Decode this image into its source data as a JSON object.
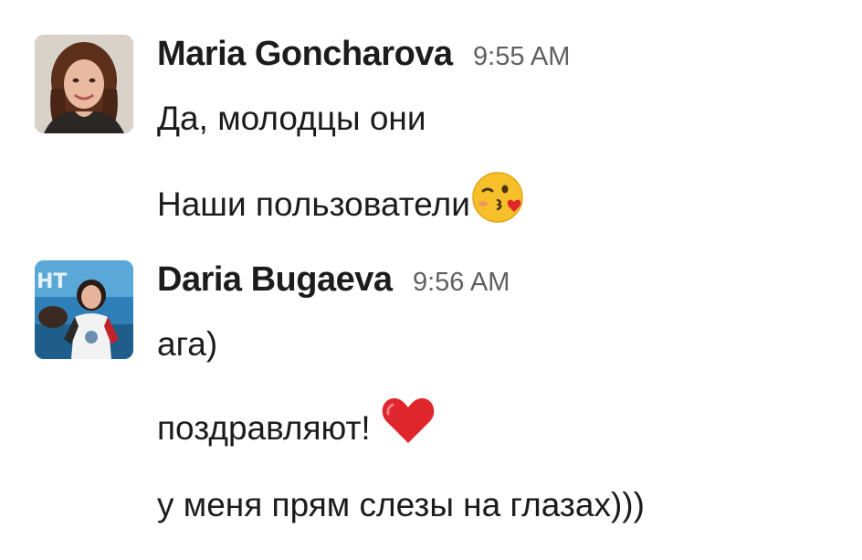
{
  "messages": [
    {
      "author": "Maria Goncharova",
      "time": "9:55 AM",
      "lines": [
        {
          "text": "Да, молодцы они",
          "emoji": ""
        },
        {
          "text": "Наши пользователи",
          "emoji": "kissing-heart-emoji"
        }
      ]
    },
    {
      "author": "Daria Bugaeva",
      "time": "9:56 AM",
      "lines": [
        {
          "text": "ага)",
          "emoji": ""
        },
        {
          "text": "поздравляют! ",
          "emoji": "red-heart-emoji"
        },
        {
          "text": "у меня прям слезы на глазах)))",
          "emoji": ""
        }
      ]
    }
  ],
  "colors": {
    "text": "#1d1c1d",
    "timestamp": "#616061",
    "heart": "#e0262d",
    "emoji_face": "#f7c02a"
  }
}
